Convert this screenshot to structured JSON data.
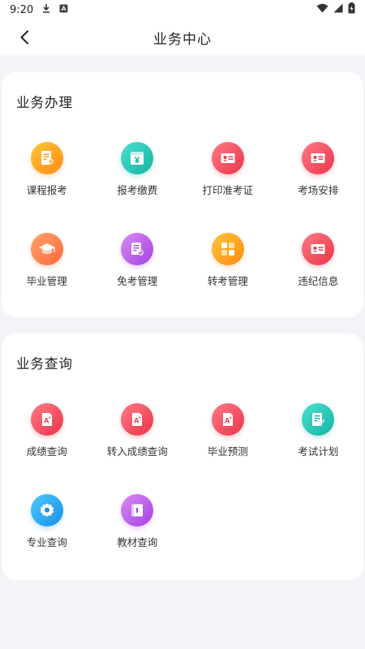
{
  "status": {
    "time": "9:20"
  },
  "header": {
    "title": "业务中心"
  },
  "sections": [
    {
      "title": "业务办理",
      "items": [
        {
          "label": "课程报考",
          "icon": "course-register-icon",
          "color": "orange"
        },
        {
          "label": "报考缴费",
          "icon": "payment-icon",
          "color": "teal"
        },
        {
          "label": "打印准考证",
          "icon": "admission-ticket-icon",
          "color": "red"
        },
        {
          "label": "考场安排",
          "icon": "exam-room-icon",
          "color": "red"
        },
        {
          "label": "毕业管理",
          "icon": "graduation-cap-icon",
          "color": "coral"
        },
        {
          "label": "免考管理",
          "icon": "exemption-icon",
          "color": "purple"
        },
        {
          "label": "转考管理",
          "icon": "transfer-icon",
          "color": "orange"
        },
        {
          "label": "违纪信息",
          "icon": "violation-info-icon",
          "color": "red"
        }
      ]
    },
    {
      "title": "业务查询",
      "items": [
        {
          "label": "成绩查询",
          "icon": "score-query-icon",
          "color": "red"
        },
        {
          "label": "转入成绩查询",
          "icon": "transfer-score-icon",
          "color": "red"
        },
        {
          "label": "毕业预测",
          "icon": "graduation-forecast-icon",
          "color": "red"
        },
        {
          "label": "考试计划",
          "icon": "exam-plan-icon",
          "color": "teal"
        },
        {
          "label": "专业查询",
          "icon": "major-query-icon",
          "color": "blue"
        },
        {
          "label": "教材查询",
          "icon": "textbook-icon",
          "color": "purple"
        }
      ]
    }
  ],
  "colors": {
    "orange": "#ff8b12",
    "teal": "#14b3a4",
    "red": "#ea3449",
    "coral": "#ff6a3a",
    "purple": "#a441e0",
    "blue": "#1990e6",
    "background": "#f3f4f8"
  }
}
